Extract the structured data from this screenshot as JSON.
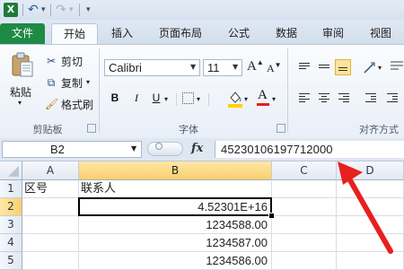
{
  "window": {
    "app_icon": "excel-logo-icon",
    "app_icon_text": "X"
  },
  "quick_access": {
    "undo_icon": "undo-icon",
    "redo_icon": "redo-icon",
    "customize_icon": "customize-dropdown-icon"
  },
  "tabs": [
    {
      "label": "文件",
      "active": false
    },
    {
      "label": "开始",
      "active": true
    },
    {
      "label": "插入",
      "active": false
    },
    {
      "label": "页面布局",
      "active": false
    },
    {
      "label": "公式",
      "active": false
    },
    {
      "label": "数据",
      "active": false
    },
    {
      "label": "审阅",
      "active": false
    },
    {
      "label": "视图",
      "active": false
    }
  ],
  "ribbon": {
    "clipboard": {
      "paste_label": "粘贴",
      "cut_label": "剪切",
      "copy_label": "复制",
      "format_painter_label": "格式刷",
      "group_label": "剪贴板"
    },
    "font": {
      "font_name": "Calibri",
      "font_size": "11",
      "bold": "B",
      "italic": "I",
      "underline": "U",
      "grow_font": "A",
      "shrink_font": "A",
      "font_color_glyph": "A",
      "group_label": "字体"
    },
    "alignment": {
      "group_label": "对齐方式"
    }
  },
  "formula_bar": {
    "name_box": "B2",
    "fx_label": "fx",
    "content": "45230106197712000"
  },
  "sheet": {
    "columns": [
      "A",
      "B",
      "C",
      "D"
    ],
    "selected_column": "B",
    "rows": [
      {
        "num": "1",
        "A": "区号",
        "B": "联系人",
        "selected": false
      },
      {
        "num": "2",
        "A": "",
        "B": "4.52301E+16",
        "selected": true
      },
      {
        "num": "3",
        "A": "",
        "B": "1234588.00",
        "selected": false
      },
      {
        "num": "4",
        "A": "",
        "B": "1234587.00",
        "selected": false
      },
      {
        "num": "5",
        "A": "",
        "B": "1234586.00",
        "selected": false
      }
    ]
  },
  "annotation": {
    "arrow_color": "#e8201e"
  },
  "colors": {
    "file_tab": "#1f8a46",
    "selected_header": "#f9cf6c",
    "ribbon_bg": "#e9eff7"
  }
}
